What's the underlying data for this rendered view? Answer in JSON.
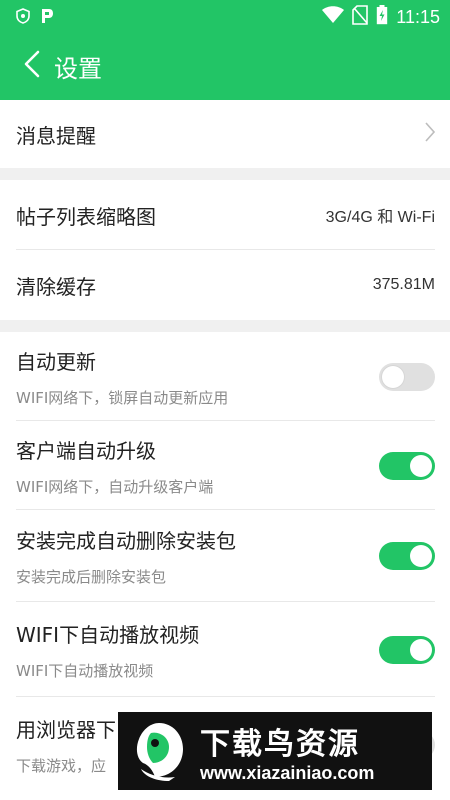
{
  "status_bar": {
    "time": "11:15",
    "icons": [
      "shield-icon",
      "p-app-icon",
      "wifi-icon",
      "no-sim-icon",
      "battery-charging-icon"
    ]
  },
  "app_bar": {
    "title": "设置",
    "back_icon": "chevron-left-icon"
  },
  "settings": {
    "notifications": {
      "label": "消息提醒"
    },
    "thumbnails": {
      "label": "帖子列表缩略图",
      "value": "3G/4G 和 Wi-Fi"
    },
    "cache": {
      "label": "清除缓存",
      "value": "375.81M"
    },
    "auto_update": {
      "label": "自动更新",
      "sub": "WIFI网络下，锁屏自动更新应用",
      "enabled": false
    },
    "client_upgrade": {
      "label": "客户端自动升级",
      "sub": "WIFI网络下，自动升级客户端",
      "enabled": true
    },
    "delete_package": {
      "label": "安装完成自动删除安装包",
      "sub": "安装完成后删除安装包",
      "enabled": true
    },
    "wifi_autoplay": {
      "label": "WIFI下自动播放视频",
      "sub": "WIFI下自动播放视频",
      "enabled": true
    },
    "browser_download": {
      "label": "用浏览器下",
      "sub": "下载游戏，应"
    }
  },
  "watermark": {
    "title": "下载鸟资源",
    "url": "www.xiazainiao.com"
  },
  "colors": {
    "primary": "#22c566",
    "toggle_off": "#e0e0e0",
    "divider": "#f0f0f0"
  }
}
